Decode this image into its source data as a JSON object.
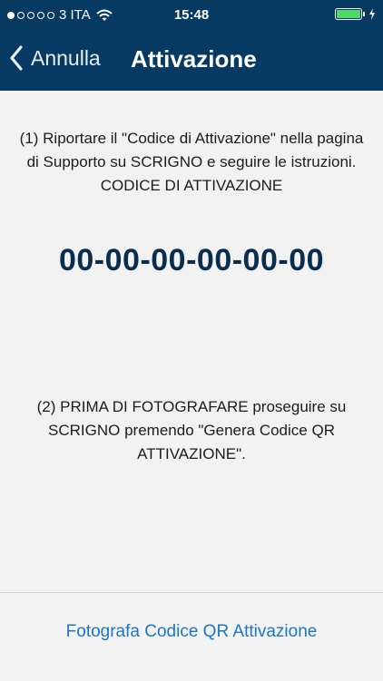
{
  "status_bar": {
    "carrier": "3 ITA",
    "time": "15:48",
    "signal_bars_filled": 1,
    "signal_bars_total": 5,
    "battery_color": "#4cd964"
  },
  "nav": {
    "back_label": "Annulla",
    "title": "Attivazione",
    "background": "#063a63"
  },
  "content": {
    "instruction1_line1": "(1) Riportare il \"Codice di Attivazione\" nella pagina",
    "instruction1_line2": "di Supporto su SCRIGNO e seguire le istruzioni.",
    "code_heading": "CODICE DI ATTIVAZIONE",
    "activation_code": "00-00-00-00-00-00",
    "instruction2_line1": "(2) PRIMA DI FOTOGRAFARE proseguire su",
    "instruction2_line2": "SCRIGNO premendo \"Genera Codice QR",
    "instruction2_line3": "ATTIVAZIONE\"."
  },
  "action": {
    "label": "Fotografa Codice QR Attivazione",
    "color": "#1a75c9"
  }
}
